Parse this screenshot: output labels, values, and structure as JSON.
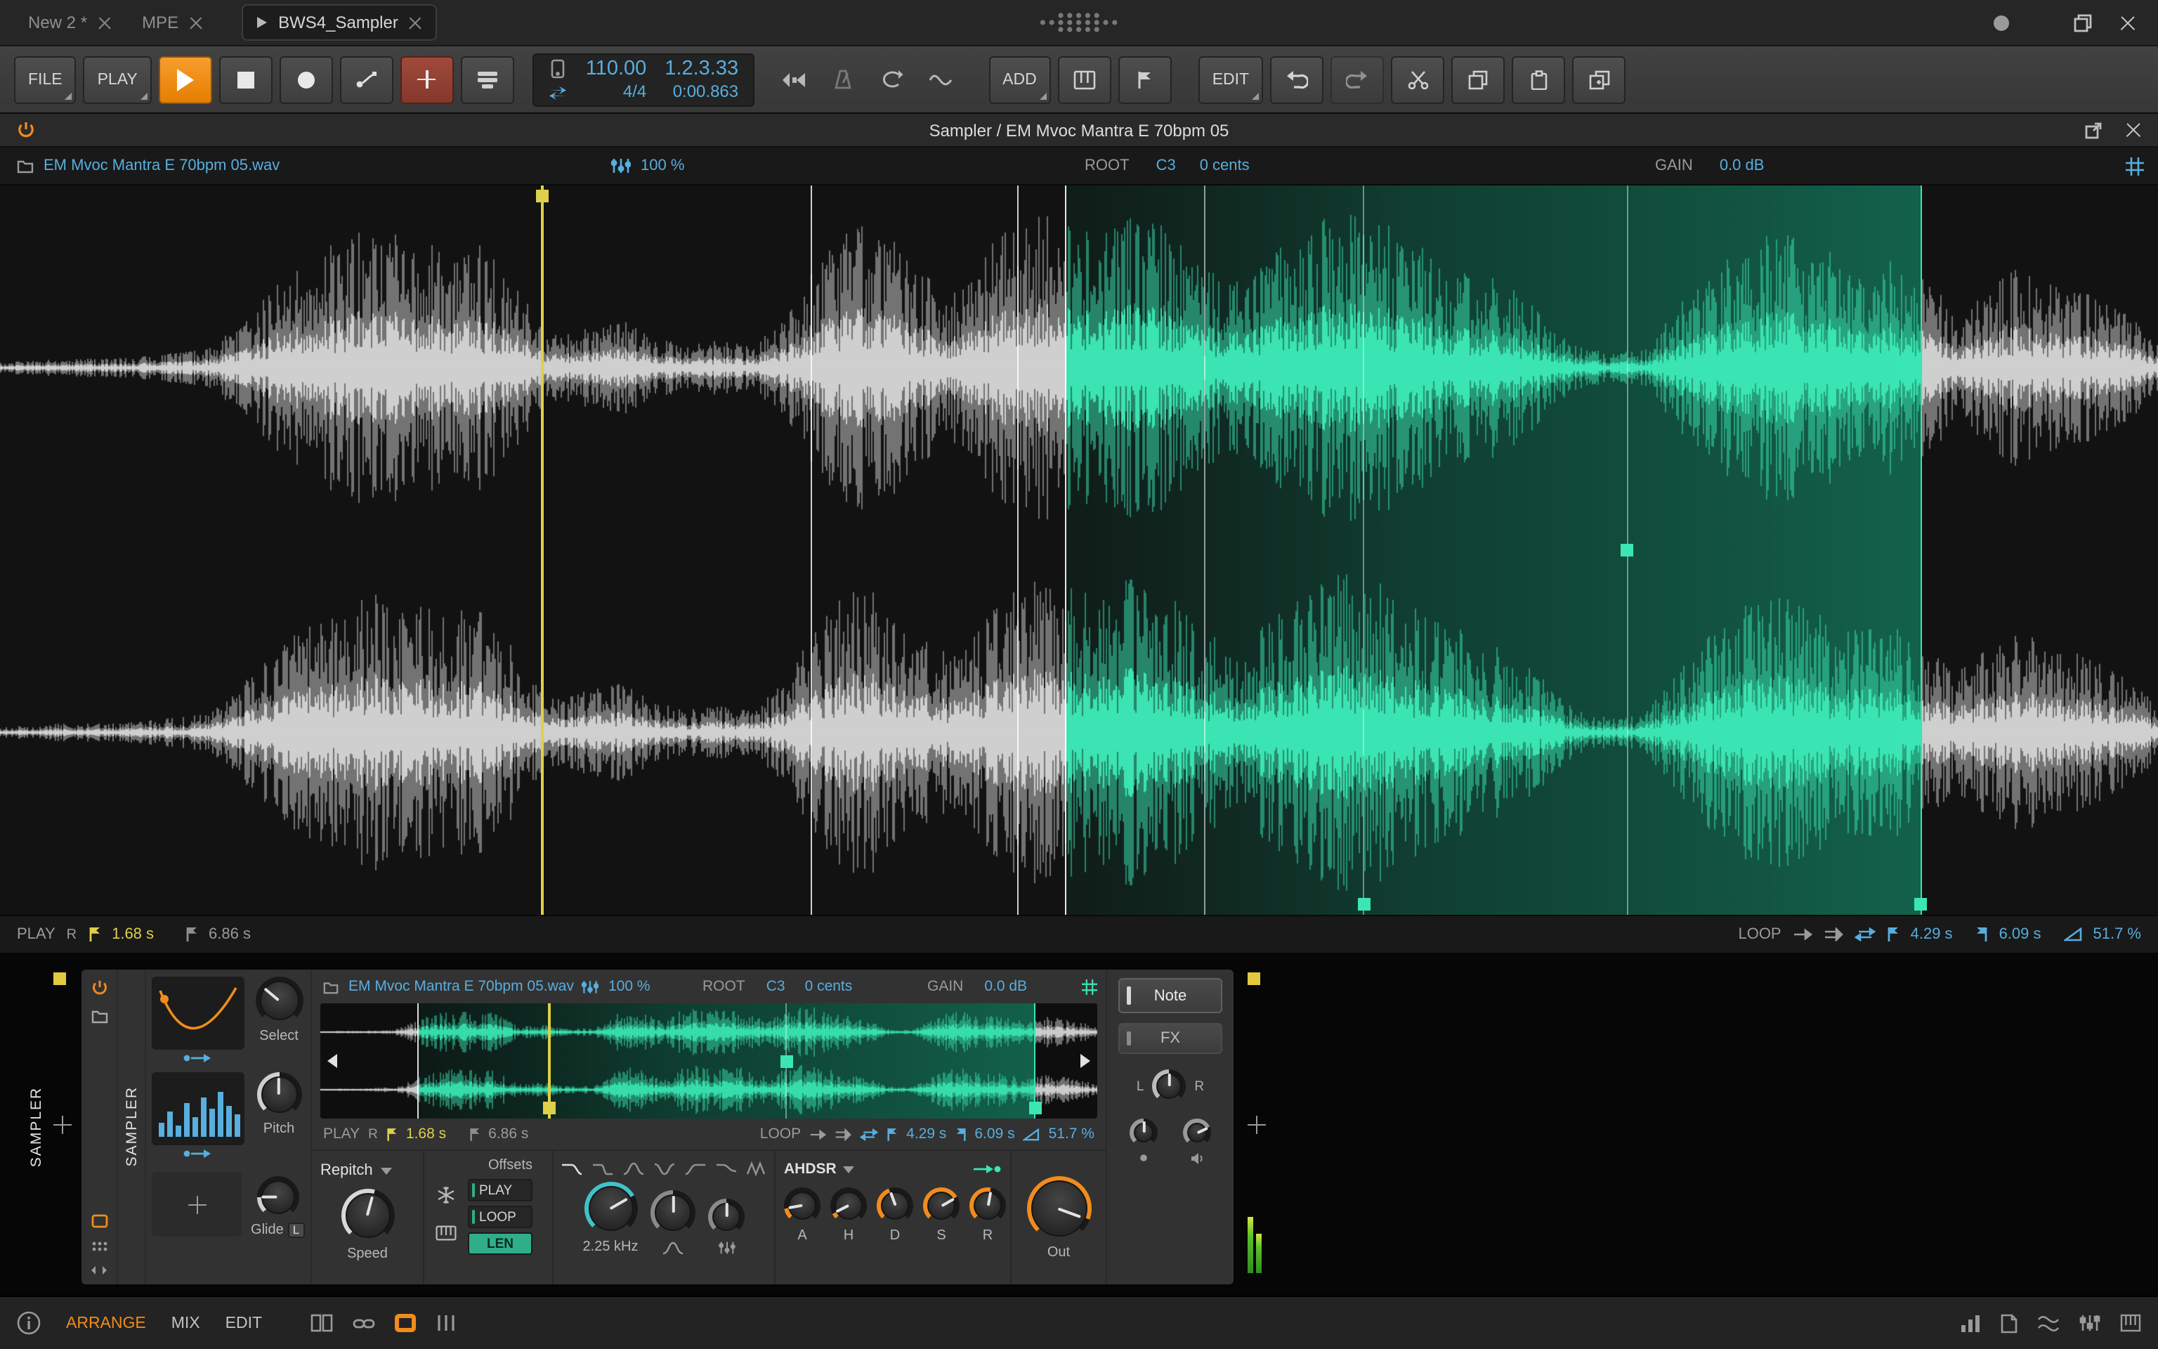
{
  "window": {
    "tabs": [
      {
        "label": "New 2 *"
      },
      {
        "label": "MPE"
      },
      {
        "label": "BWS4_Sampler"
      }
    ]
  },
  "toolbar": {
    "file": "FILE",
    "play": "PLAY",
    "add": "ADD",
    "edit": "EDIT",
    "tempo": "110.00",
    "time_sig": "4/4",
    "position": "1.2.3.33",
    "time": "0:00.863"
  },
  "editor": {
    "title": "Sampler / EM Mvoc Mantra E 70bpm 05"
  },
  "sample": {
    "file": "EM Mvoc Mantra E 70bpm 05.wav",
    "stretch": "100 %",
    "root_label": "ROOT",
    "root": "C3",
    "cents": "0 cents",
    "gain_label": "GAIN",
    "gain": "0.0 dB",
    "play_label": "PLAY",
    "restart": "R",
    "start": "1.68 s",
    "length": "6.86 s",
    "loop_label": "LOOP",
    "loop_start": "4.29 s",
    "loop_end": "6.09 s",
    "loop_fade": "51.7 %"
  },
  "device": {
    "chain_label": "SAMPLER",
    "name": "SAMPLER",
    "select_label": "Select",
    "pitch_label": "Pitch",
    "glide_label": "Glide",
    "glide_badge": "L",
    "mode": "Repitch",
    "speed_label": "Speed",
    "offsets_label": "Offsets",
    "offset_play": "PLAY",
    "offset_loop": "LOOP",
    "offset_len": "LEN",
    "cutoff": "2.25 kHz",
    "env_title": "AHDSR",
    "env_labels": [
      "A",
      "H",
      "D",
      "S",
      "R"
    ],
    "out_label": "Out",
    "tab_note": "Note",
    "tab_fx": "FX",
    "pan_left": "L",
    "pan_right": "R"
  },
  "statusbar": {
    "arrange": "ARRANGE",
    "mix": "MIX",
    "edit": "EDIT"
  },
  "waveform": {
    "envelope": [
      0.03,
      0.04,
      0.05,
      0.05,
      0.06,
      0.08,
      0.1,
      0.25,
      0.45,
      0.6,
      0.72,
      0.75,
      0.7,
      0.65,
      0.68,
      0.45,
      0.18,
      0.22,
      0.28,
      0.18,
      0.12,
      0.15,
      0.12,
      0.3,
      0.65,
      0.8,
      0.72,
      0.5,
      0.4,
      0.7,
      0.85,
      0.8,
      0.75,
      0.85,
      0.78,
      0.55,
      0.48,
      0.6,
      0.75,
      0.88,
      0.85,
      0.72,
      0.6,
      0.55,
      0.45,
      0.3,
      0.12,
      0.08,
      0.1,
      0.35,
      0.55,
      0.7,
      0.75,
      0.68,
      0.55,
      0.6,
      0.5,
      0.35,
      0.45,
      0.55,
      0.48,
      0.4,
      0.3,
      0.15
    ],
    "big": {
      "loop": [
        0.494,
        0.89
      ],
      "markers": [
        {
          "x": 0.251,
          "w": 2,
          "color": "#ded04a",
          "handle": "top",
          "handleColor": "#ded04a",
          "name": "play-start-marker"
        },
        {
          "x": 0.376,
          "color": "rgba(255,255,255,0.8)",
          "name": "slice-marker-1"
        },
        {
          "x": 0.472,
          "color": "rgba(255,255,255,0.8)",
          "name": "slice-marker-2"
        },
        {
          "x": 0.494,
          "color": "rgba(255,255,255,0.9)",
          "name": "loop-start-marker"
        },
        {
          "x": 0.558,
          "color": "rgba(255,255,255,0.55)",
          "name": "slice-marker-3"
        },
        {
          "x": 0.632,
          "color": "rgba(214,255,239,0.45)",
          "handle": "bottom",
          "handleColor": "#3be6b4",
          "name": "loop-fade-marker"
        },
        {
          "x": 0.754,
          "color": "rgba(214,255,239,0.45)",
          "handle": "mid",
          "handleColor": "#3be6b4",
          "name": "loop-crossfade-marker"
        },
        {
          "x": 0.89,
          "color": "#3be6b4",
          "handle": "bottom",
          "handleColor": "#3be6b4",
          "name": "loop-end-marker"
        }
      ]
    },
    "mini": {
      "loop": [
        0.125,
        0.92
      ],
      "markers": [
        {
          "x": 0.125,
          "color": "rgba(255,255,255,0.85)",
          "name": "mini-loop-start-marker"
        },
        {
          "x": 0.295,
          "w": 2,
          "color": "#ded04a",
          "handle": "bottom",
          "handleColor": "#ded04a",
          "name": "mini-play-start-marker"
        },
        {
          "x": 0.6,
          "color": "rgba(214,255,239,0.45)",
          "handle": "mid",
          "handleColor": "#3be6b4",
          "name": "mini-crossfade-marker"
        },
        {
          "x": 0.92,
          "color": "#3be6b4",
          "handle": "bottom",
          "handleColor": "#3be6b4",
          "name": "mini-loop-end-marker"
        }
      ]
    }
  },
  "colors": {
    "accent": "#f08c1e",
    "blue": "#58aede",
    "teal": "#3be6b4",
    "yellow": "#ded04a"
  }
}
